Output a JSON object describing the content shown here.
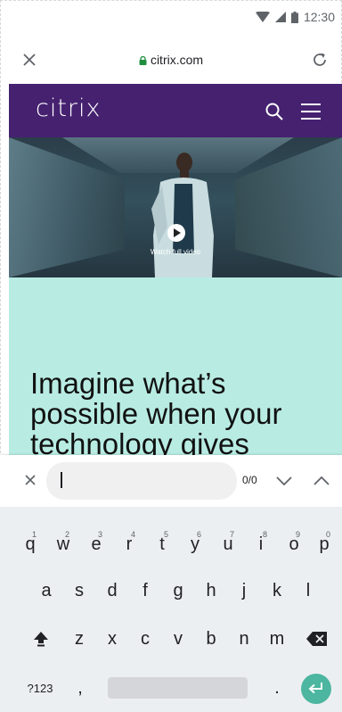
{
  "status_bar": {
    "time": "12:30"
  },
  "browser": {
    "url": "citrix.com"
  },
  "site": {
    "logo": "citrix",
    "hero_caption": "Watch full video",
    "headline_lines": [
      "Imagine what’s",
      "possible when your",
      "technology gives"
    ]
  },
  "find_bar": {
    "count": "0/0"
  },
  "keyboard": {
    "row1": [
      "q",
      "w",
      "e",
      "r",
      "t",
      "y",
      "u",
      "i",
      "o",
      "p"
    ],
    "row1_hints": [
      "1",
      "2",
      "3",
      "4",
      "5",
      "6",
      "7",
      "8",
      "9",
      "0"
    ],
    "row2": [
      "a",
      "s",
      "d",
      "f",
      "g",
      "h",
      "j",
      "k",
      "l"
    ],
    "row3": [
      "z",
      "x",
      "c",
      "v",
      "b",
      "n",
      "m"
    ],
    "symbols_key": "?123",
    "comma": ",",
    "period": "."
  },
  "colors": {
    "header_purple": "#452170",
    "content_teal": "#b8ece3",
    "enter_key": "#4cb6a0",
    "lock_green": "#1e8e3e"
  }
}
